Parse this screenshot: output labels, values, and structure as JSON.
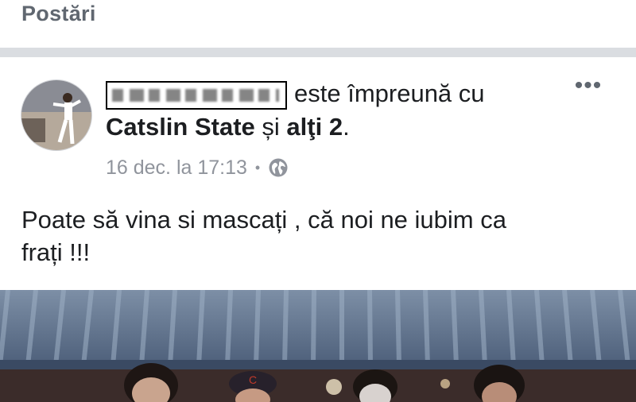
{
  "section": {
    "title": "Postări"
  },
  "post": {
    "redacted_name": "",
    "with_text": "este împreună cu",
    "tagged_name": "Catslin State",
    "conjunction": "și",
    "others_link": "alţi 2",
    "period": ".",
    "more_label": "•••",
    "timestamp": "16 dec. la 17:13",
    "separator": "•",
    "privacy_icon": "globe-icon",
    "text_line1": "Poate să vina si mascați , că noi ne iubim ca",
    "text_line2": "frați !!!"
  },
  "colors": {
    "title_gray": "#606770",
    "meta_gray": "#90949c",
    "divider": "#dadde1",
    "text": "#1c1e21"
  }
}
